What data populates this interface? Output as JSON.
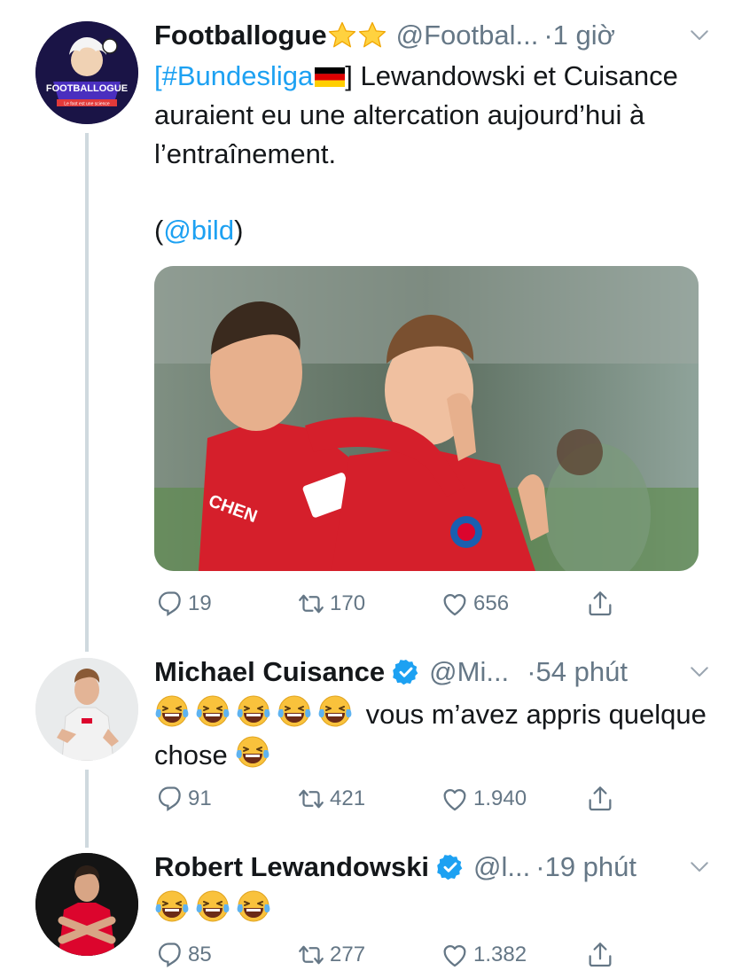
{
  "tweets": [
    {
      "name": "Footballogue",
      "handle": "@Footbal...",
      "time": "·1 giờ",
      "avatar_text": "FOOTBALLOGUE",
      "avatar_sub": "Le foot est une science",
      "text_hashtag": "[#Bundesliga",
      "text_rest": "] Lewandowski et Cuisance auraient eu une altercation aujourd’hui à l’entraînement.",
      "source_open": "(",
      "source_mention": "@bild",
      "source_close": ")",
      "photo_labels": [
        "CHEN"
      ],
      "reply_count": "19",
      "retweet_count": "170",
      "like_count": "656"
    },
    {
      "name": "Michael Cuisance",
      "handle": "@Mi...",
      "time": "·54 phút",
      "text": "vous m’avez appris quelque chose",
      "reply_count": "91",
      "retweet_count": "421",
      "like_count": "1.940"
    },
    {
      "name": "Robert Lewandowski",
      "handle": "@l...",
      "time": "·19 phút",
      "reply_count": "85",
      "retweet_count": "277",
      "like_count": "1.382"
    }
  ],
  "colors": {
    "link": "#1da1f2",
    "muted": "#657786",
    "verified": "#1da1f2",
    "jersey_red": "#dc052d"
  },
  "icons": [
    "reply-icon",
    "retweet-icon",
    "like-icon",
    "share-icon",
    "chevron-down-icon",
    "verified-badge-icon",
    "star-emoji",
    "laughing-emoji",
    "germany-flag"
  ]
}
